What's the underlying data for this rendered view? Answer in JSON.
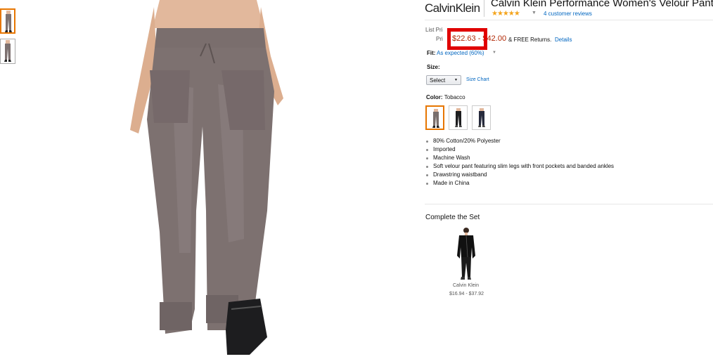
{
  "brand": {
    "logo": "CalvinKlein"
  },
  "product": {
    "title": "Calvin Klein Performance Women's Velour Pant",
    "stars": "★★★★★",
    "reviews": "4 customer reviews",
    "list_price_label": "List Pri",
    "price_label": "Pri",
    "price": "$22.63 - $42.00",
    "returns": "& FREE Returns.",
    "details_link": "Details",
    "fit_label": "Fit:",
    "fit_value": "As expected (60%)",
    "size_label": "Size:",
    "size_selected": "Select",
    "size_chart": "Size Chart",
    "color_label": "Color:",
    "color_value": "Tobacco",
    "swatches": [
      {
        "name": "Tobacco",
        "color": "#7a6f6c"
      },
      {
        "name": "Black",
        "color": "#1d1d1f"
      },
      {
        "name": "Navy",
        "color": "#262a3c"
      }
    ],
    "bullets": [
      "80% Cotton/20% Polyester",
      "Imported",
      "Machine Wash",
      "Soft velour pant featuring slim legs with front pockets and banded ankles",
      "Drawstring waistband",
      "Made in China"
    ]
  },
  "complete_set": {
    "title": "Complete the Set",
    "item_brand": "Calvin Klein",
    "item_price": "$16.94 - $37.92"
  },
  "colors": {
    "pant": "#7d7170",
    "skin": "#e2b89c",
    "link": "#0066c0",
    "price": "#b12704",
    "highlight": "#e00000",
    "selected_border": "#e77600"
  }
}
